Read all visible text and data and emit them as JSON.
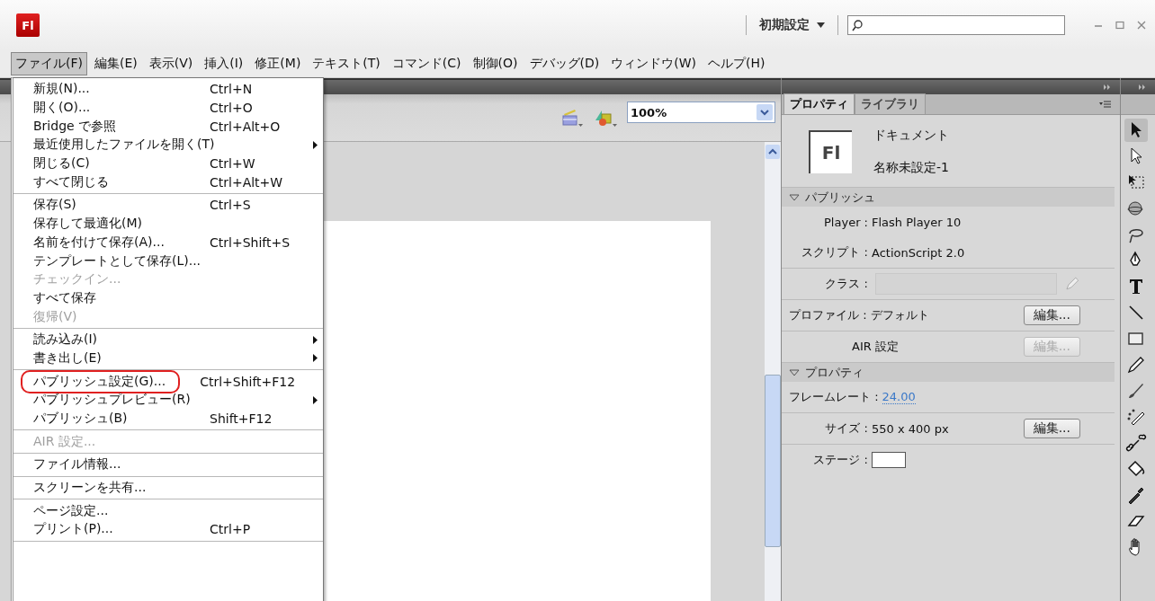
{
  "app": {
    "logo": "Fl",
    "workspace": "初期設定"
  },
  "menubar": [
    {
      "label": "ファイル(F)",
      "selected": true
    },
    {
      "label": "編集(E)",
      "selected": false
    },
    {
      "label": "表示(V)",
      "selected": false
    },
    {
      "label": "挿入(I)",
      "selected": false
    },
    {
      "label": "修正(M)",
      "selected": false
    },
    {
      "label": "テキスト(T)",
      "selected": false
    },
    {
      "label": "コマンド(C)",
      "selected": false
    },
    {
      "label": "制御(O)",
      "selected": false
    },
    {
      "label": "デバッグ(D)",
      "selected": false
    },
    {
      "label": "ウィンドウ(W)",
      "selected": false
    },
    {
      "label": "ヘルプ(H)",
      "selected": false
    }
  ],
  "file_menu": {
    "sections": [
      [
        {
          "label": "新規(N)...",
          "shortcut": "Ctrl+N",
          "submenu": false,
          "disabled": false,
          "circled": false
        },
        {
          "label": "開く(O)...",
          "shortcut": "Ctrl+O",
          "submenu": false,
          "disabled": false,
          "circled": false
        },
        {
          "label": "Bridge で参照",
          "shortcut": "Ctrl+Alt+O",
          "submenu": false,
          "disabled": false,
          "circled": false
        },
        {
          "label": "最近使用したファイルを開く(T)",
          "submenu": true,
          "disabled": false,
          "circled": false
        },
        {
          "label": "閉じる(C)",
          "shortcut": "Ctrl+W",
          "submenu": false,
          "disabled": false,
          "circled": false
        },
        {
          "label": "すべて閉じる",
          "shortcut": "Ctrl+Alt+W",
          "submenu": false,
          "disabled": false,
          "circled": false
        }
      ],
      [
        {
          "label": "保存(S)",
          "shortcut": "Ctrl+S",
          "submenu": false,
          "disabled": false,
          "circled": false
        },
        {
          "label": "保存して最適化(M)",
          "submenu": false,
          "disabled": false,
          "circled": false
        },
        {
          "label": "名前を付けて保存(A)...",
          "shortcut": "Ctrl+Shift+S",
          "submenu": false,
          "disabled": false,
          "circled": false
        },
        {
          "label": "テンプレートとして保存(L)...",
          "submenu": false,
          "disabled": false,
          "circled": false
        },
        {
          "label": "チェックイン...",
          "submenu": false,
          "disabled": true,
          "circled": false
        },
        {
          "label": "すべて保存",
          "submenu": false,
          "disabled": false,
          "circled": false
        },
        {
          "label": "復帰(V)",
          "submenu": false,
          "disabled": true,
          "circled": false
        }
      ],
      [
        {
          "label": "読み込み(I)",
          "submenu": true,
          "disabled": false,
          "circled": false
        },
        {
          "label": "書き出し(E)",
          "submenu": true,
          "disabled": false,
          "circled": false
        }
      ],
      [
        {
          "label": "パブリッシュ設定(G)...",
          "shortcut": "Ctrl+Shift+F12",
          "submenu": false,
          "disabled": false,
          "circled": true
        },
        {
          "label": "パブリッシュプレビュー(R)",
          "submenu": true,
          "disabled": false,
          "circled": false
        },
        {
          "label": "パブリッシュ(B)",
          "shortcut": "Shift+F12",
          "submenu": false,
          "disabled": false,
          "circled": false
        }
      ],
      [
        {
          "label": "AIR 設定...",
          "submenu": false,
          "disabled": true,
          "circled": false
        }
      ],
      [
        {
          "label": "ファイル情報...",
          "submenu": false,
          "disabled": false,
          "circled": false
        }
      ],
      [
        {
          "label": "スクリーンを共有...",
          "submenu": false,
          "disabled": false,
          "circled": false
        }
      ],
      [
        {
          "label": "ページ設定...",
          "submenu": false,
          "disabled": false,
          "circled": false
        },
        {
          "label": "プリント(P)...",
          "shortcut": "Ctrl+P",
          "submenu": false,
          "disabled": false,
          "circled": false
        }
      ]
    ]
  },
  "document": {
    "zoom": "100%"
  },
  "panel": {
    "tabs": [
      {
        "label": "プロパティ",
        "selected": true
      },
      {
        "label": "ライブラリ",
        "selected": false
      }
    ],
    "header": {
      "icon_text": "Fl",
      "kind_label": "ドキュメント",
      "name": "名称未設定-1"
    },
    "sections": [
      {
        "title": "パブリッシュ",
        "expanded": true,
        "rows": [
          {
            "kind": "text",
            "label": "Player :",
            "value": "Flash Player 10"
          },
          {
            "kind": "text",
            "label": "スクリプト :",
            "value": "ActionScript 2.0"
          },
          {
            "kind": "field",
            "label": "クラス :"
          },
          {
            "kind": "plain_button",
            "label": "プロファイル : デフォルト",
            "button": "編集...",
            "disabled": false
          },
          {
            "kind": "button",
            "label": "AIR 設定",
            "button": "編集...",
            "disabled": true
          }
        ]
      },
      {
        "title": "プロパティ",
        "expanded": true,
        "rows": [
          {
            "kind": "plain_link",
            "label": "フレームレート :",
            "value": "24.00"
          },
          {
            "kind": "text_button",
            "label": "サイズ :",
            "value": "550 x 400 px",
            "button": "編集...",
            "disabled": false
          },
          {
            "kind": "swatch",
            "label": "ステージ :",
            "color": "#ffffff"
          }
        ]
      }
    ]
  }
}
